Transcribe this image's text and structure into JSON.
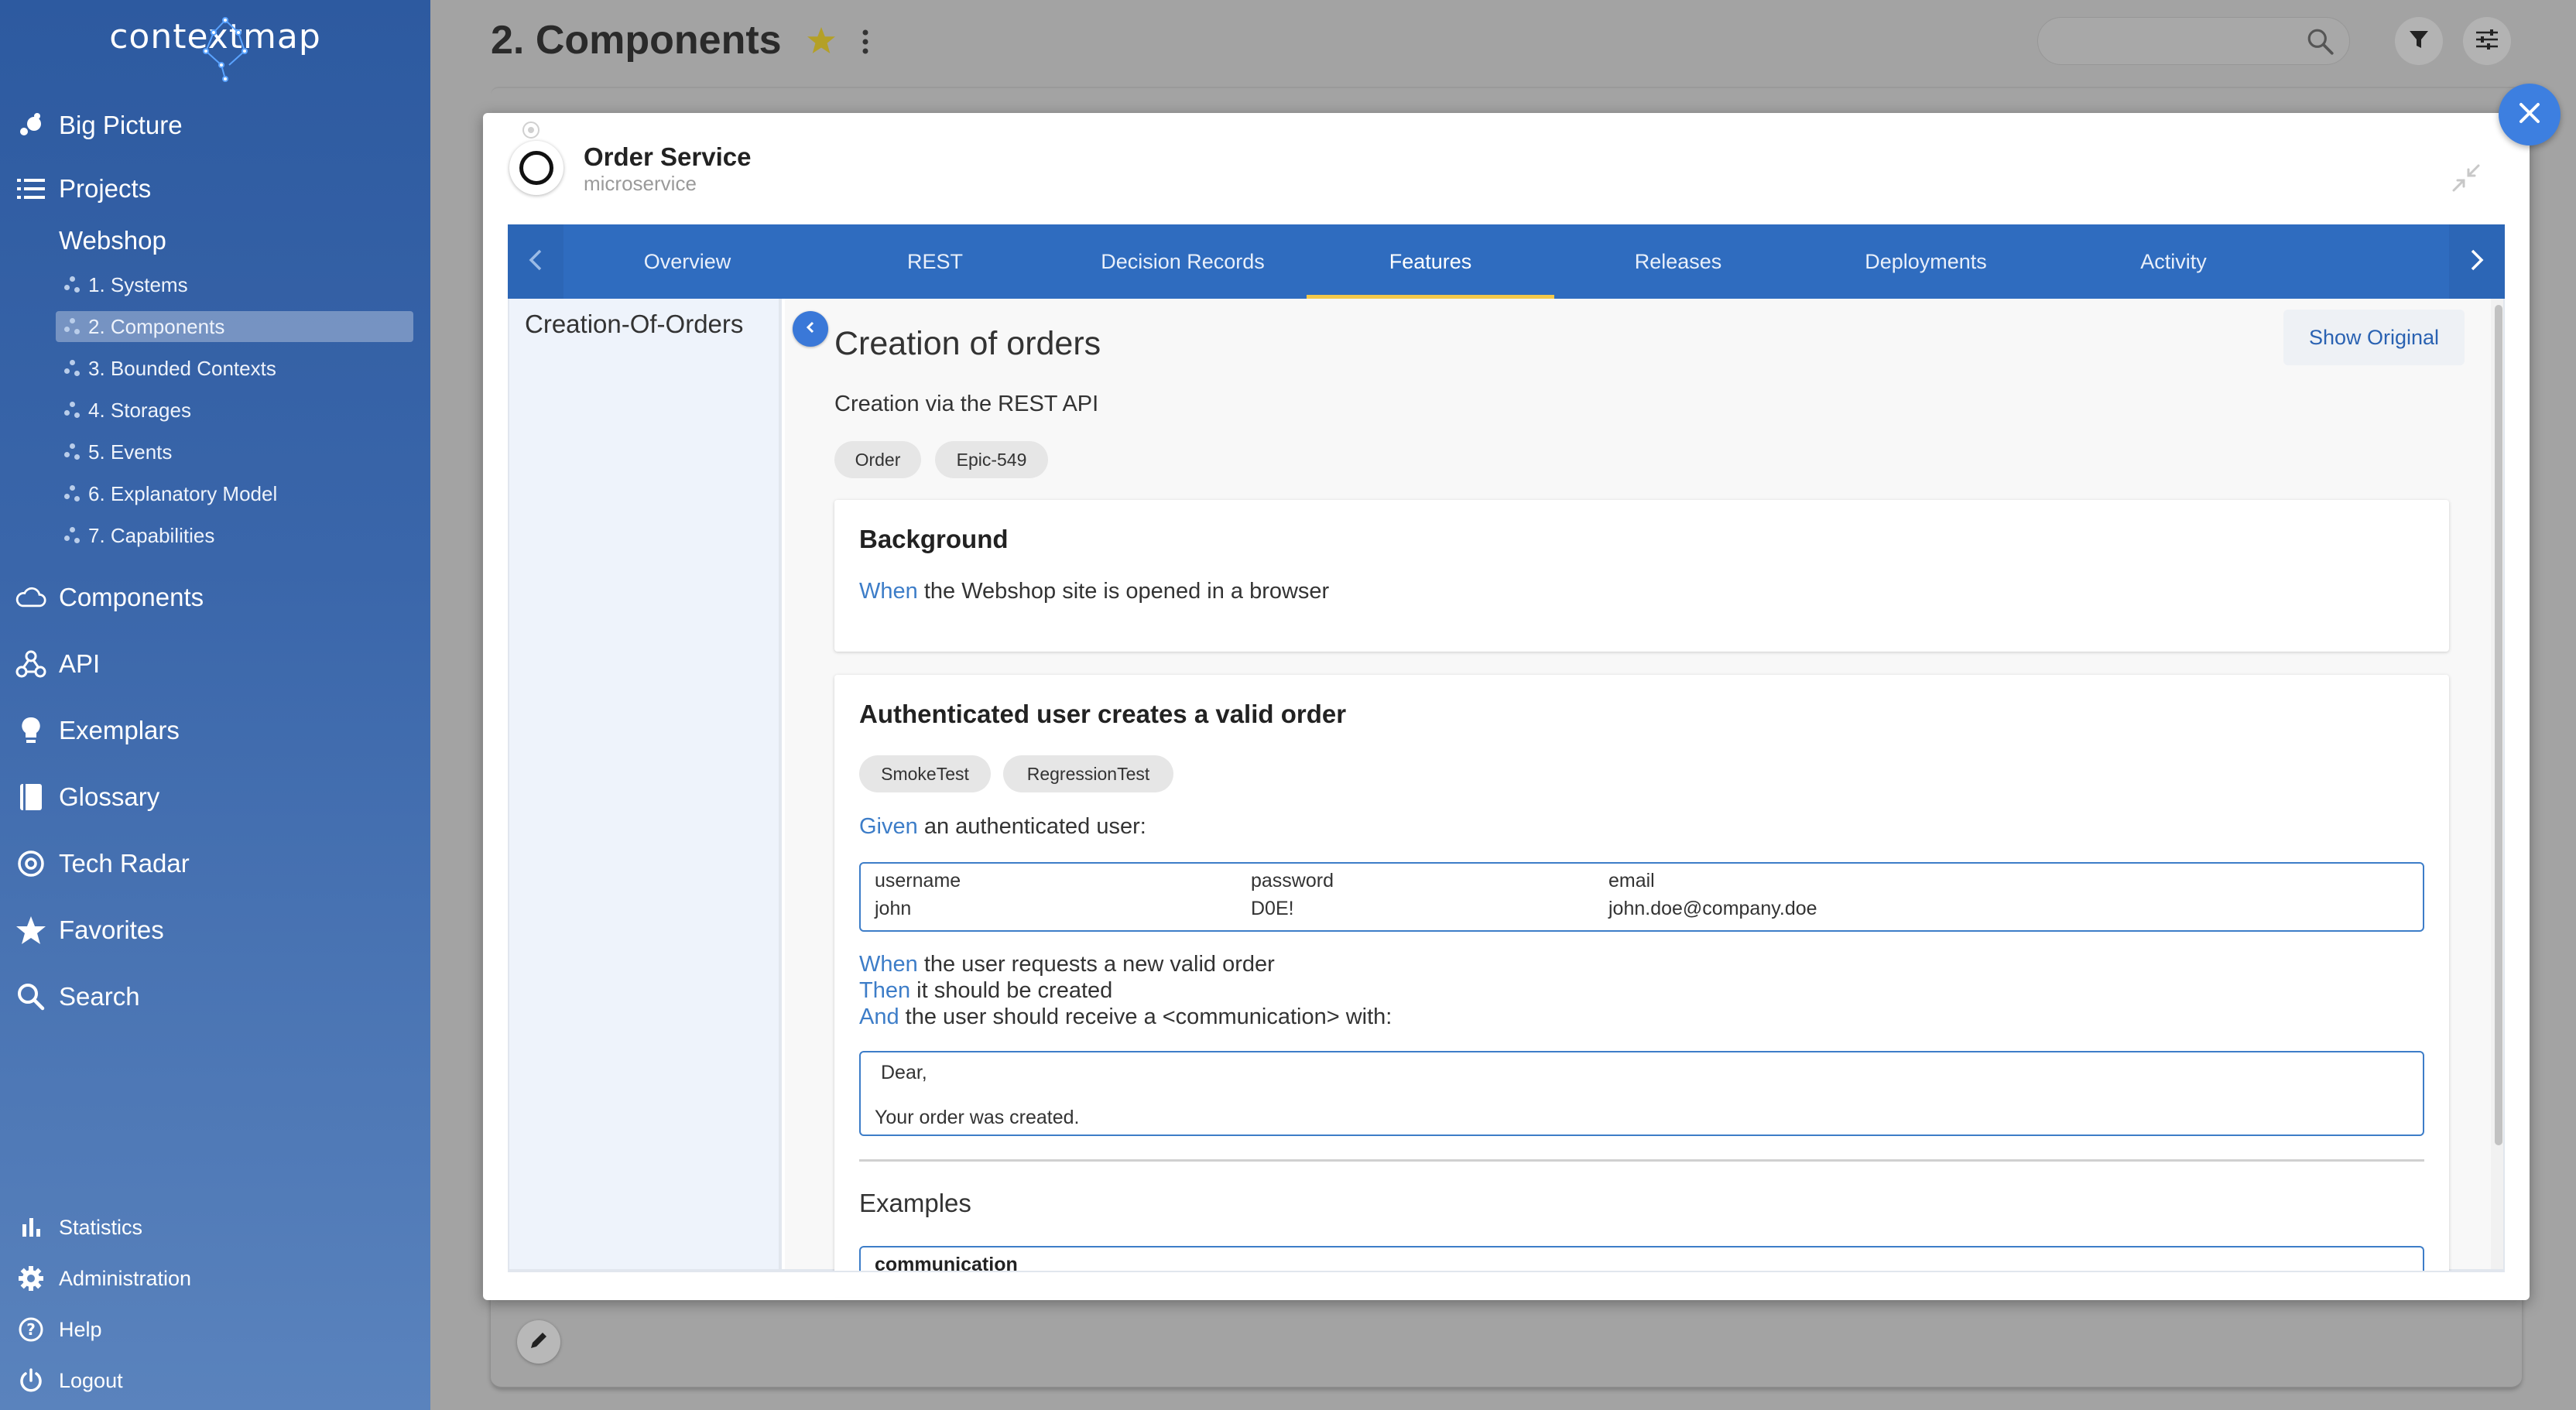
{
  "app": {
    "logo_text": "contextmap"
  },
  "sidebar": {
    "nav": [
      {
        "label": "Big Picture",
        "icon": "bubbles-icon"
      },
      {
        "label": "Projects",
        "icon": "list-icon"
      }
    ],
    "project_name": "Webshop",
    "project_items": [
      {
        "label": "1. Systems",
        "active": false
      },
      {
        "label": "2. Components",
        "active": true
      },
      {
        "label": "3. Bounded Contexts",
        "active": false
      },
      {
        "label": "4. Storages",
        "active": false
      },
      {
        "label": "5. Events",
        "active": false
      },
      {
        "label": "6. Explanatory Model",
        "active": false
      },
      {
        "label": "7. Capabilities",
        "active": false
      }
    ],
    "nav2": [
      {
        "label": "Components",
        "icon": "cloud-icon"
      },
      {
        "label": "API",
        "icon": "webhook-icon"
      },
      {
        "label": "Exemplars",
        "icon": "lightbulb-icon"
      },
      {
        "label": "Glossary",
        "icon": "book-icon"
      },
      {
        "label": "Tech Radar",
        "icon": "radar-icon"
      },
      {
        "label": "Favorites",
        "icon": "star-icon"
      },
      {
        "label": "Search",
        "icon": "search-icon"
      }
    ],
    "bottom": [
      {
        "label": "Statistics",
        "icon": "bar-chart-icon"
      },
      {
        "label": "Administration",
        "icon": "gear-icon"
      },
      {
        "label": "Help",
        "icon": "help-icon"
      },
      {
        "label": "Logout",
        "icon": "power-icon"
      }
    ]
  },
  "header": {
    "title": "2. Components",
    "search_placeholder": ""
  },
  "modal": {
    "service_name": "Order Service",
    "service_type": "microservice",
    "tabs": [
      {
        "label": "Overview",
        "active": false
      },
      {
        "label": "REST",
        "active": false
      },
      {
        "label": "Decision Records",
        "active": false
      },
      {
        "label": "Features",
        "active": true
      },
      {
        "label": "Releases",
        "active": false
      },
      {
        "label": "Deployments",
        "active": false
      },
      {
        "label": "Activity",
        "active": false
      }
    ],
    "feature_list": [
      "Creation-Of-Orders"
    ],
    "show_original_label": "Show Original"
  },
  "feature": {
    "title": "Creation of orders",
    "description": "Creation via the REST API",
    "tags": [
      "Order",
      "Epic-549"
    ],
    "background": {
      "title": "Background",
      "steps": [
        {
          "keyword": "When",
          "text": " the Webshop site is opened in a browser"
        }
      ]
    },
    "scenario": {
      "title": "Authenticated user creates a valid order",
      "tags": [
        "SmokeTest",
        "RegressionTest"
      ],
      "given": {
        "keyword": "Given",
        "text": " an authenticated user:"
      },
      "table": {
        "headers": [
          "username",
          "password",
          "email"
        ],
        "rows": [
          [
            "john",
            "D0E!",
            "john.doe@company.doe"
          ]
        ]
      },
      "steps": [
        {
          "keyword": "When",
          "text": " the user requests a new valid order"
        },
        {
          "keyword": "Then",
          "text": " it should be created"
        },
        {
          "keyword": "And",
          "text": " the user should receive a <communication> with:"
        }
      ],
      "docstring": [
        "Dear,",
        "Your order was created."
      ],
      "examples_title": "Examples",
      "examples_header": "communication"
    }
  },
  "colors": {
    "sidebar": "#2d5aa0",
    "tabbar": "#2f6cbf",
    "active_tab_underline": "#f3c94b",
    "keyword": "#3d7dc8",
    "fab": "#3d7fe0"
  }
}
